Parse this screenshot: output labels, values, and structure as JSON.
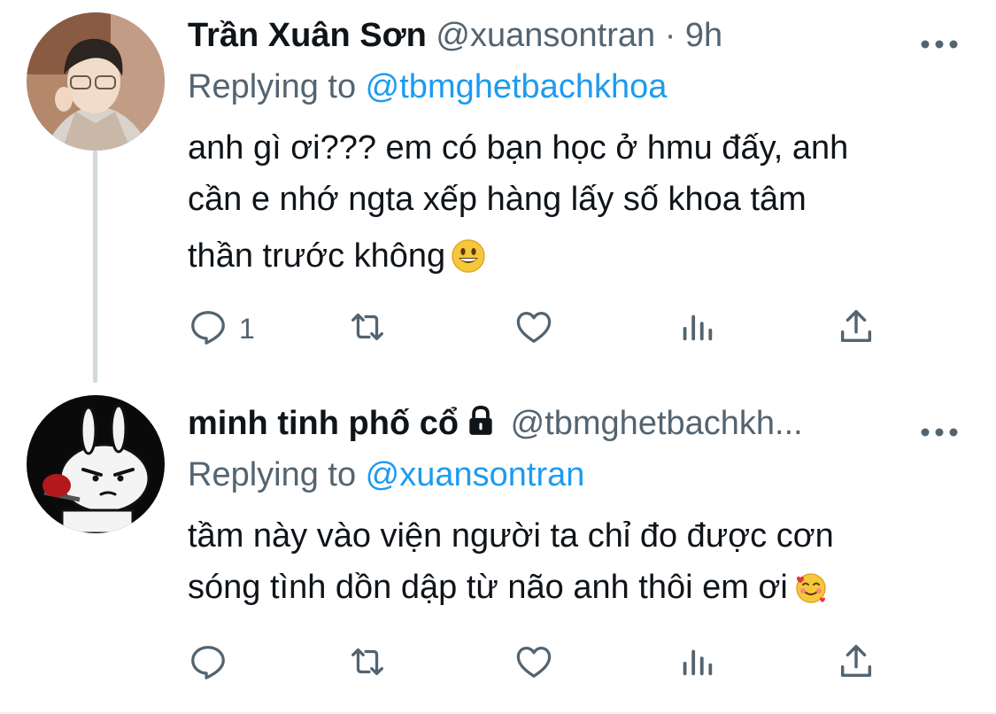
{
  "tweets": [
    {
      "author_name": "Trần Xuân Sơn",
      "author_handle": "@xuansontran",
      "separator": " · ",
      "time": "9h",
      "replying_prefix": "Replying to ",
      "replying_to": "@tbmghetbachkhoa",
      "text_lines": [
        "anh gì ơi??? em có bạn học ở hmu đấy, anh",
        "cần e nhớ ngta xếp hàng lấy số khoa tâm",
        "thần trước không"
      ],
      "emoji": "grinning-face-emoji",
      "reply_count": "1",
      "icons": [
        "reply-icon",
        "retweet-icon",
        "like-icon",
        "analytics-icon",
        "share-icon",
        "more-icon"
      ]
    },
    {
      "author_name": "minh tinh phố cổ",
      "author_handle": "@tbmghetbachkh...",
      "protected": true,
      "replying_prefix": "Replying to ",
      "replying_to": "@xuansontran",
      "text_lines": [
        "tầm này vào viện người ta chỉ đo được cơn",
        "sóng tình dồn dập từ não anh thôi em ơi"
      ],
      "emoji": "smiling-face-with-hearts-emoji",
      "reply_count": "",
      "icons": [
        "reply-icon",
        "retweet-icon",
        "like-icon",
        "analytics-icon",
        "share-icon",
        "more-icon",
        "lock-icon"
      ]
    }
  ],
  "colors": {
    "text": "#0f1419",
    "secondary": "#536471",
    "accent": "#1d9bf0",
    "thread_line": "#cfd9de",
    "background": "#ffffff"
  }
}
